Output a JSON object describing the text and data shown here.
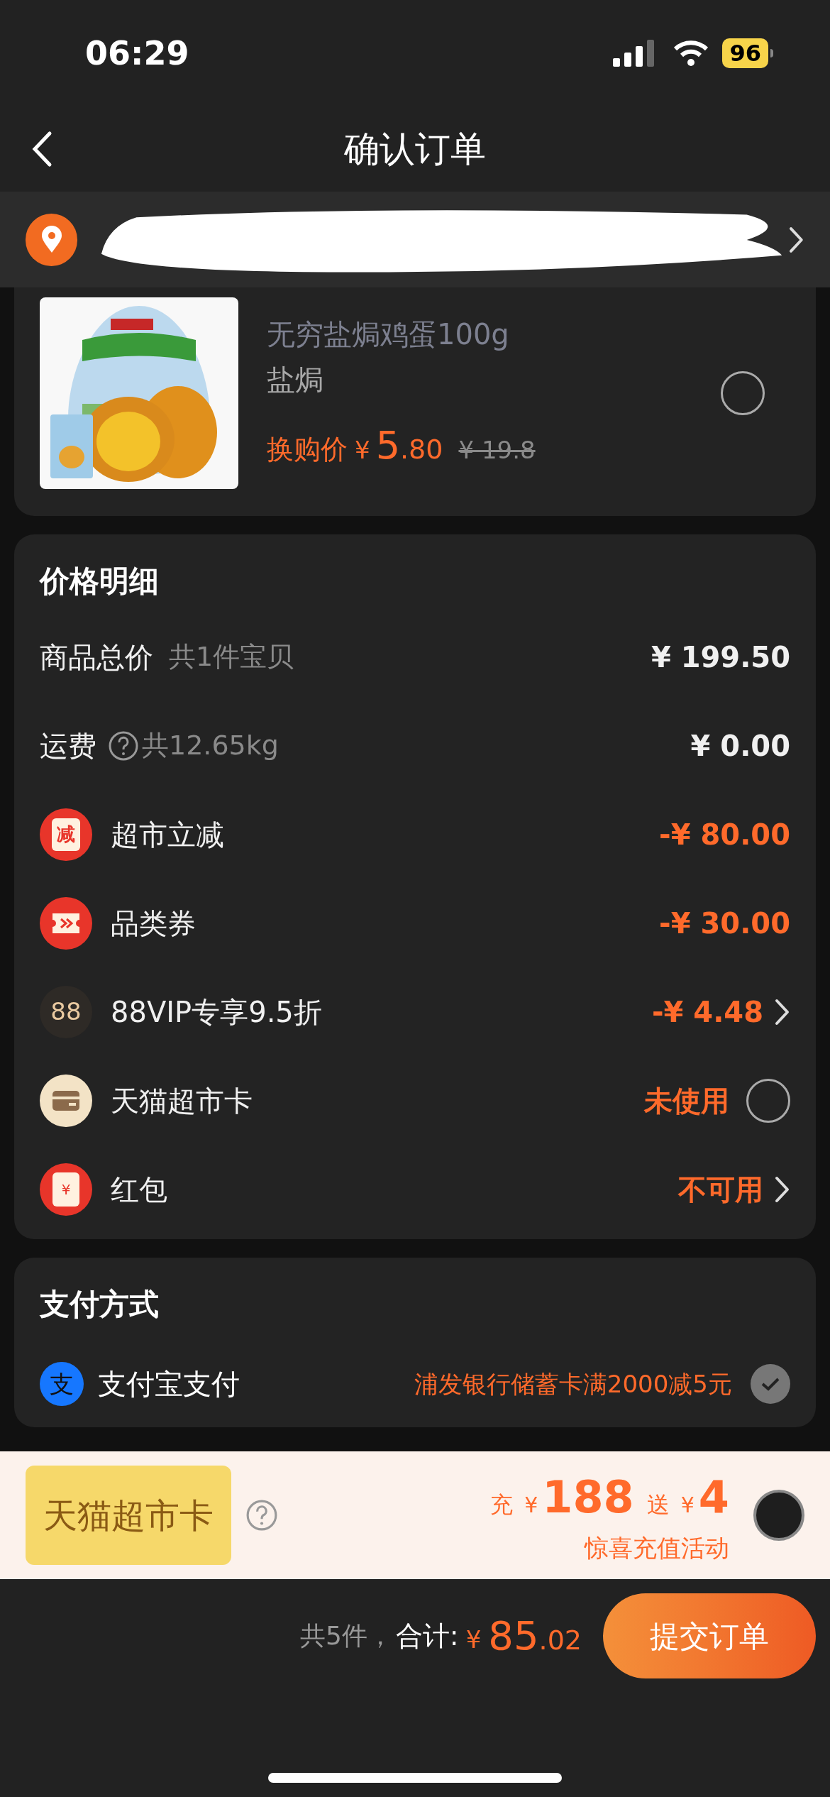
{
  "status_bar": {
    "time": "06:29",
    "battery": "96"
  },
  "nav": {
    "title": "确认订单"
  },
  "product": {
    "name": "无穷盐焗鸡蛋100g",
    "variant": "盐焗",
    "price_label": "换购价",
    "price_symbol": "¥",
    "price_int": "5",
    "price_dec": ".80",
    "original_price": "¥ 19.8",
    "selected": false
  },
  "price_detail": {
    "title": "价格明细",
    "rows": [
      {
        "kind": "plain",
        "label": "商品总价",
        "note": "共1件宝贝",
        "value": "¥ 199.50"
      },
      {
        "kind": "help",
        "label": "运费",
        "note": "共12.65kg",
        "value": "¥ 0.00"
      },
      {
        "kind": "discount",
        "icon_text": "减",
        "label": "超市立减",
        "value": "-¥ 80.00"
      },
      {
        "kind": "discount",
        "label": "品类券",
        "value": "-¥ 30.00"
      },
      {
        "kind": "link",
        "icon_text": "88",
        "label": "88VIP专享9.5折",
        "value": "-¥ 4.48"
      },
      {
        "kind": "toggle",
        "label": "天猫超市卡",
        "value": "未使用",
        "checked": false
      },
      {
        "kind": "link",
        "icon_text": "¥",
        "label": "红包",
        "value": "不可用"
      }
    ]
  },
  "payment": {
    "title": "支付方式",
    "icon_text": "支",
    "name": "支付宝支付",
    "promo": "浦发银行储蓄卡满2000减5元",
    "selected": true
  },
  "recharge": {
    "card_label": "天猫超市卡",
    "charge_label": "充",
    "charge_symbol": "¥",
    "charge_amount": "188",
    "bonus_label": "送",
    "bonus_symbol": "¥",
    "bonus_amount": "4",
    "subtitle": "惊喜充值活动",
    "selected": false
  },
  "footer": {
    "count": "共5件，",
    "total_label": "合计:",
    "symbol": "¥",
    "total_int": "85",
    "total_dec": ".02",
    "submit": "提交订单"
  }
}
